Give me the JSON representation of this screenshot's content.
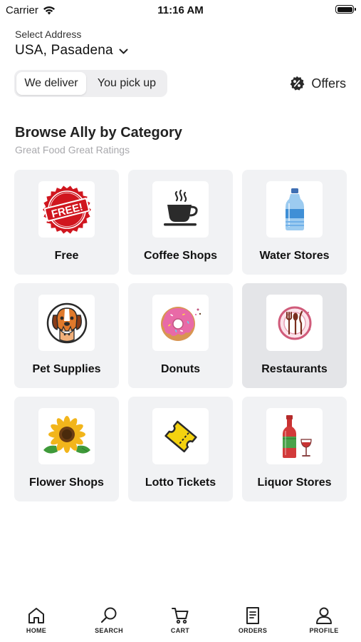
{
  "status_bar": {
    "carrier": "Carrier",
    "time": "11:16 AM"
  },
  "address": {
    "label": "Select Address",
    "value": "USA, Pasadena"
  },
  "delivery_toggle": {
    "options": [
      "We deliver",
      "You pick up"
    ],
    "selected": "We deliver"
  },
  "offers": {
    "label": "Offers"
  },
  "section": {
    "title": "Browse Ally by Category",
    "subtitle": "Great Food Great Ratings"
  },
  "categories": [
    {
      "name": "Free",
      "icon": "free-badge-icon"
    },
    {
      "name": "Coffee Shops",
      "icon": "coffee-cup-icon"
    },
    {
      "name": "Water Stores",
      "icon": "water-bottle-icon"
    },
    {
      "name": "Pet Supplies",
      "icon": "dog-cat-icon"
    },
    {
      "name": "Donuts",
      "icon": "donut-icon"
    },
    {
      "name": "Restaurants",
      "icon": "plate-utensils-icon"
    },
    {
      "name": "Flower Shops",
      "icon": "sunflower-icon"
    },
    {
      "name": "Lotto Tickets",
      "icon": "ticket-icon"
    },
    {
      "name": "Liquor Stores",
      "icon": "liquor-bottle-icon"
    }
  ],
  "free_badge_text": "FREE!",
  "tabs": [
    {
      "label": "HOME",
      "icon": "home-icon"
    },
    {
      "label": "SEARCH",
      "icon": "search-icon"
    },
    {
      "label": "CART",
      "icon": "cart-icon"
    },
    {
      "label": "ORDERS",
      "icon": "orders-icon"
    },
    {
      "label": "PROFILE",
      "icon": "profile-icon"
    }
  ],
  "colors": {
    "card_bg": "#f1f2f4",
    "selected_card_bg": "#e4e5e8",
    "badge_red": "#d0161f"
  }
}
